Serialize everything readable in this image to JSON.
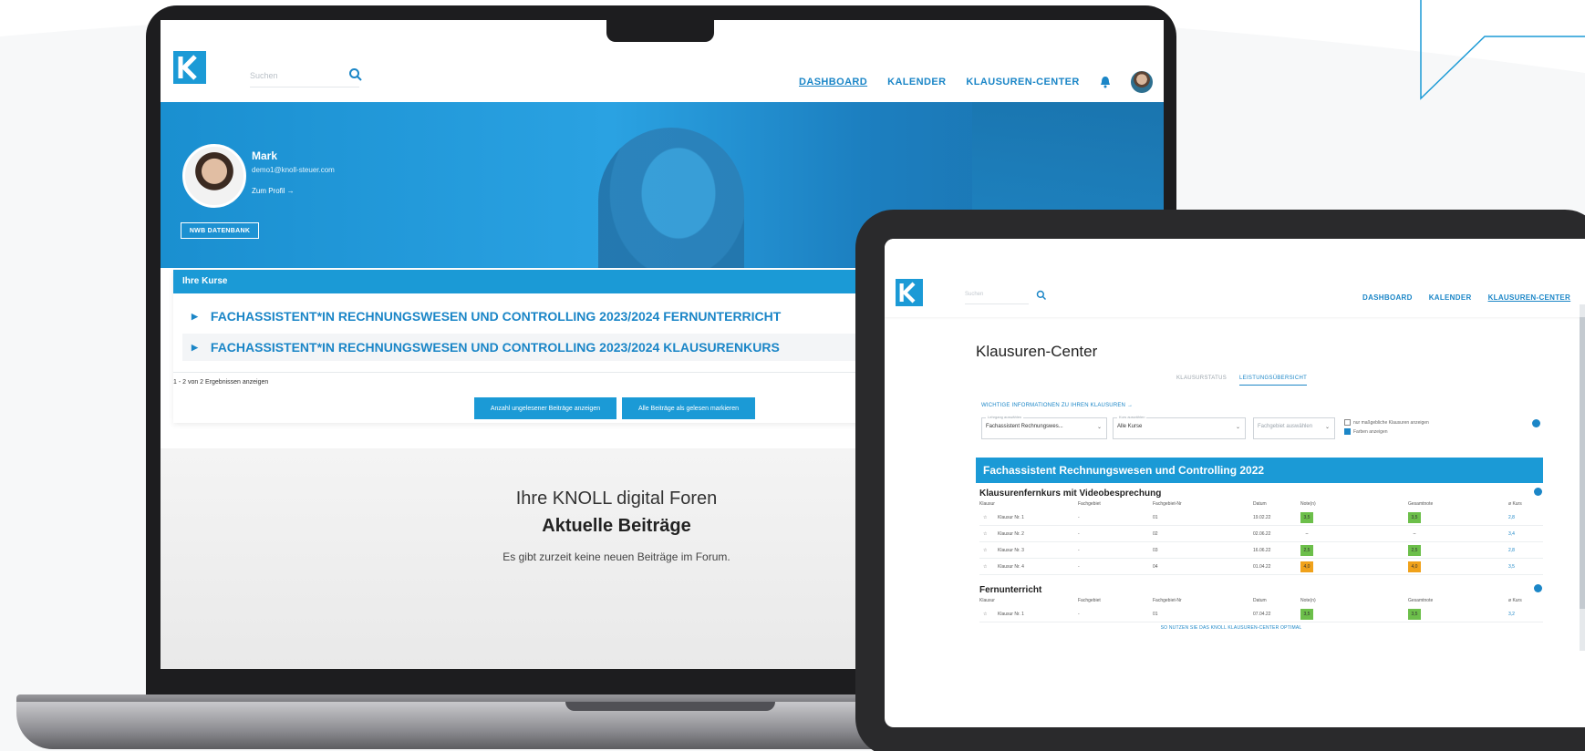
{
  "colors": {
    "brand_blue": "#1b9ad6",
    "link_blue": "#1b86c7",
    "grade_green": "#6cbf4a",
    "grade_orange": "#f0a21b"
  },
  "laptop": {
    "nav": {
      "search_placeholder": "Suchen",
      "links": [
        "DASHBOARD",
        "KALENDER",
        "KLAUSUREN-CENTER"
      ],
      "active_link": "DASHBOARD"
    },
    "profile": {
      "name": "Mark",
      "email": "demo1@knoll-steuer.com",
      "profile_link": "Zum Profil →",
      "nwb_button": "NWB DATENBANK"
    },
    "courses": {
      "header": "Ihre Kurse",
      "items": [
        "FACHASSISTENT*IN RECHNUNGSWESEN UND CONTROLLING 2023/2024 FERNUNTERRICHT",
        "FACHASSISTENT*IN RECHNUNGSWESEN UND CONTROLLING 2023/2024 KLAUSURENKURS"
      ],
      "result_count": "1 - 2 von 2 Ergebnissen anzeigen",
      "btn_unread": "Anzahl ungelesener Beiträge anzeigen",
      "btn_mark_read": "Alle Beiträge als gelesen markieren"
    },
    "forum": {
      "title": "Ihre KNOLL digital Foren",
      "subtitle": "Aktuelle Beiträge",
      "empty": "Es gibt zurzeit keine neuen Beiträge im Forum."
    }
  },
  "tablet": {
    "nav": {
      "search_placeholder": "Suchen",
      "links": [
        "DASHBOARD",
        "KALENDER",
        "KLAUSUREN-CENTER"
      ],
      "active_link": "KLAUSUREN-CENTER"
    },
    "title": "Klausuren-Center",
    "tabs": [
      "KLAUSURSTATUS",
      "LEISTUNGSÜBERSICHT"
    ],
    "active_tab": "LEISTUNGSÜBERSICHT",
    "info_link": "WICHTIGE INFORMATIONEN ZU IHREN KLAUSUREN →",
    "filters": {
      "course": {
        "label": "Lehrgang auswählen",
        "value": "Fachassistent Rechnungswes..."
      },
      "kurs": {
        "label": "Kurs auswählen",
        "value": "Alle Kurse"
      },
      "fachgebiet": {
        "value": "Fachgebiet auswählen"
      },
      "check_unfinished": "nur maßgebliche Klausuren anzeigen",
      "check_colors": "Farben anzeigen"
    },
    "banner": "Fachassistent Rechnungswesen und Controlling 2022",
    "columns": [
      "Klausur",
      "Fachgebiet",
      "Fachgebiet-Nr",
      "Datum",
      "Note(n)",
      "Gesamtnote",
      "ø Kurs"
    ],
    "sections": [
      {
        "title": "Klausurenfernkurs mit Videobesprechung",
        "rows": [
          {
            "klausur": "Klausur Nr. 1",
            "fachgebiet": "-",
            "nr": "01",
            "datum": "19.02.22",
            "note": "3,5",
            "gesamt": "3,5",
            "kurs": "2,8",
            "color": "green"
          },
          {
            "klausur": "Klausur Nr. 2",
            "fachgebiet": "-",
            "nr": "02",
            "datum": "02.06.22",
            "note": "–",
            "gesamt": "–",
            "kurs": "3,4",
            "color": "none"
          },
          {
            "klausur": "Klausur Nr. 3",
            "fachgebiet": "-",
            "nr": "03",
            "datum": "16.06.22",
            "note": "2,5",
            "gesamt": "2,5",
            "kurs": "2,8",
            "color": "green"
          },
          {
            "klausur": "Klausur Nr. 4",
            "fachgebiet": "-",
            "nr": "04",
            "datum": "01.04.22",
            "note": "4,0",
            "gesamt": "4,0",
            "kurs": "3,5",
            "color": "orange"
          }
        ]
      },
      {
        "title": "Fernunterricht",
        "rows": [
          {
            "klausur": "Klausur Nr. 1",
            "fachgebiet": "-",
            "nr": "01",
            "datum": "07.04.22",
            "note": "3,5",
            "gesamt": "3,5",
            "kurs": "3,2",
            "color": "green"
          }
        ]
      }
    ],
    "footer_link": "SO NUTZEN SIE DAS KNOLL KLAUSUREN-CENTER OPTIMAL"
  }
}
